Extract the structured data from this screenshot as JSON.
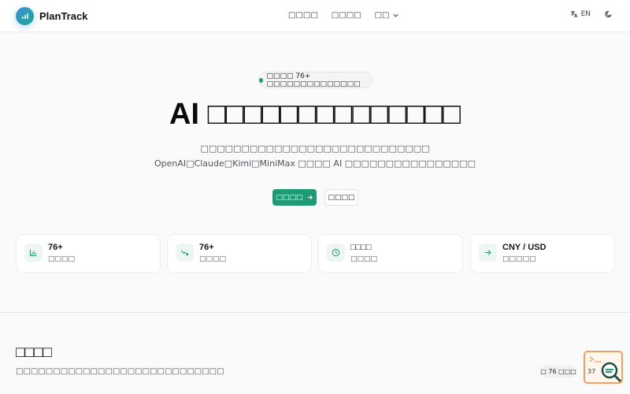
{
  "nav": {
    "brand": "PlanTrack",
    "links": [
      "□□□□",
      "□□□□"
    ],
    "more": "□□",
    "lang": "EN"
  },
  "hero": {
    "badge": "□□□□ 76+ □□□□□□□□□□□□□□",
    "title": "AI □□□□□□□□□□□□□□",
    "subtitle": "□□□□□□□□□□□□□□□□□□□□□□□□□□□□ OpenAI□Claude□Kimi□MiniMax □□□□ AI □□□□□□□□□□□□□□□□",
    "primary_button": "□□□□",
    "secondary_button": "□□□□"
  },
  "stats": [
    {
      "icon": "bar-chart-icon",
      "value": "76+",
      "label": "□□□□"
    },
    {
      "icon": "trend-down-icon",
      "value": "76+",
      "label": "□□□□"
    },
    {
      "icon": "clock-icon",
      "value": "□□□□",
      "label": "□□□□"
    },
    {
      "icon": "arrow-right-icon",
      "value": "CNY / USD",
      "label": "□□□□□"
    }
  ],
  "section": {
    "title": "□□□□",
    "subtitle": "□□□□□□□□□□□□□□□□□□□□□□□□□□□□",
    "count": "□ 76 □□□",
    "widget_text": "37"
  },
  "colors": {
    "accent": "#1e9a74",
    "logo_from": "#3a8fd8",
    "logo_to": "#1aa892",
    "widget_border": "#f0a060"
  }
}
